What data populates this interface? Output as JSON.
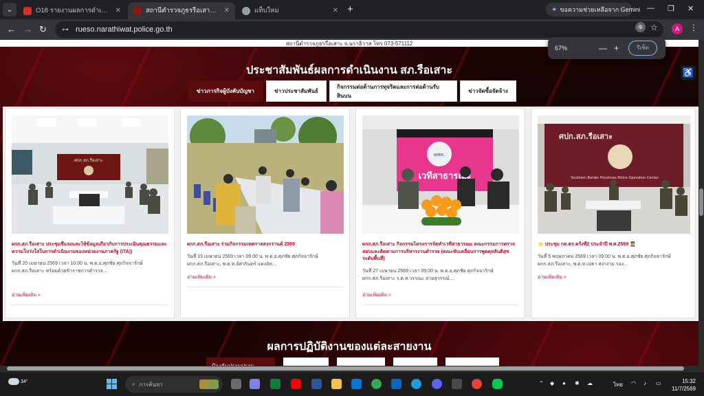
{
  "browser": {
    "tabs": [
      {
        "title": "O18 รายงานผลการดำเนินงานตามแผ",
        "active": false,
        "favicon_color": "#d93025"
      },
      {
        "title": "สถานีตำรวจภูธรรือเสาะ – RUESO POLICE",
        "active": true,
        "favicon_color": "#8b1a1a"
      },
      {
        "title": "แท็บใหม่",
        "active": false,
        "favicon_color": "#9aa0a6"
      }
    ],
    "gemini_label": "ขอความช่วยเหลือจาก Gemini",
    "url": "rueso.narathiwat.police.go.th",
    "avatar_letter": "A",
    "zoom": {
      "level": "67%",
      "reset_label": "รีเซ็ต"
    }
  },
  "page": {
    "top_strip_text": "สถานีตำรวจภูธรรือเสาะ จ.นราธิวาส  โทร 073-571112",
    "section_title": "ประชาสัมพันธ์ผลการดำเนินงาน สภ.รือเสาะ",
    "category_tabs": [
      {
        "label": "ข่าวภารกิจผู้บังคับบัญชา",
        "active": true
      },
      {
        "label": "ข่าวประชาสัมพันธ์",
        "active": false
      },
      {
        "label": "กิจกรรมต่อต้านการทุจริตและการต่อต้านรับสินบน",
        "active": false
      },
      {
        "label": "ข่าวจัดซื้อจัดจ้าง",
        "active": false
      }
    ],
    "cards": [
      {
        "headline": "ผกก.สภ.รือเสาะ ประชุมชี้แจงและให้ข้อมูลเกี่ยวกับการประเมินคุณธรรมและความโปร่งใสในการดำเนินงานของหน่วยงานภาครัฐ (ITA))",
        "excerpt": "วันที่ 20 เมษายน 2569 เวลา 10.00 น. พ.ต.อ.ศุภชัย ศุภกิจจารักษ์ ผกก.สภ.รือเสาะ พร้อมด้วยข้าราชการตำรวจ...",
        "read_more": "อ่านเพิ่มเติม »"
      },
      {
        "headline": "ผกก.สภ.รือเสาะ ร่วมกิจกรรมเทศกาลสงกรานต์ 2569",
        "excerpt": "วันที่ 13 เมษายน 2569 เวลา 09.00 น. พ.ต.อ.ศุภชัย ศุภกิจจารักษ์ ผกก.สภ.รือเสาะ, พ.ต.ท.อัศวรินทร์ แดงอิท...",
        "read_more": "อ่านเพิ่มเติม »"
      },
      {
        "headline": "ผกก.สภ.รือเสาะ กิจกรรมโครงการจัดทำเวทีสาธารณะ คณะกรรมการตรวจสอบและติดตามการบริหารงานตำรวจ (คณะขับเคลื่อนการพูดคุยสันติสุขระดับพื้นที่)",
        "excerpt": "วันที่ 27 เมษายน 2569 เวลา 09.00 น. พ.ต.อ.ศุภชัย ศุภกิจจารักษ์ ผกก.สภ.รือเสาะ ร.ต.ท.วรรณะ สายสุวรรณ์...",
        "read_more": "อ่านเพิ่มเติม »"
      },
      {
        "headline": "⭐ ประชุม กต.ตร.ครั้งที่2 ประจำปี พ.ศ.2569 👮",
        "excerpt": "วันที่ 5 พฤษภาคม 2569 เวลา 09.00 น. พ.ต.อ.ศุภชัย ศุภกิจจารักษ์ ผกก.สภ.รือเสาะ, พ.ต.ท.เมธา สง่างาม รอง...",
        "read_more": "อ่านเพิ่มเติม »"
      }
    ],
    "photo_banner_1": "ศปก.สภ.รือเสาะ",
    "photo_banner_4": "ศปก.สภ.รือเสาะ",
    "photo_banner_4_sub": "Southern Border Provinces Police Operation Center",
    "photo_logo_3": "คพท.",
    "photo_banner_3": "เวทีสาธารณะ",
    "section_title_2": "ผลการปฏิบัติงานของแต่ละสายงาน",
    "unit_tabs_first_label": "ป้องกันปราบปราม"
  },
  "taskbar": {
    "weather_temp": "34°",
    "search_placeholder": "การค้นหา",
    "language": "ไทย",
    "time": "15:32",
    "date": "11/7/2569"
  }
}
